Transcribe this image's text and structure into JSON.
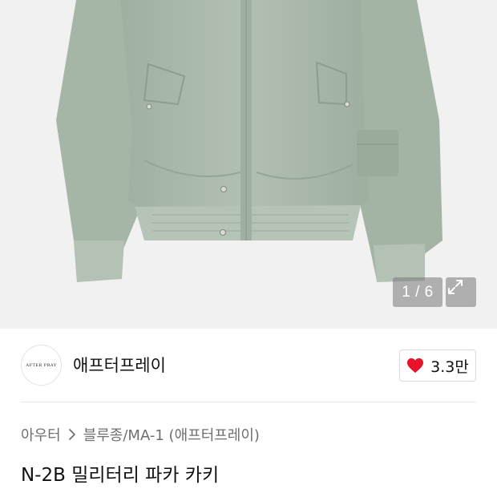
{
  "gallery": {
    "counter": "1 / 6",
    "image_alt": "N-2B 밀리터리 파카 카키 jacket photo",
    "expand_icon": "expand-icon"
  },
  "brand": {
    "logo_text": "AFTER PRAY",
    "name": "애프터프레이"
  },
  "like": {
    "icon": "heart-icon",
    "count": "3.3만",
    "heart_color": "#e8132b"
  },
  "breadcrumb": {
    "category": "아우터",
    "separator_icon": "chevron-right-icon",
    "subcategory": "블루종/MA-1 (애프터프레이)"
  },
  "product": {
    "title": "N-2B 밀리터리 파카 카키"
  },
  "colors": {
    "jacket": "#a9b8aa",
    "background": "#f1f1f1"
  }
}
